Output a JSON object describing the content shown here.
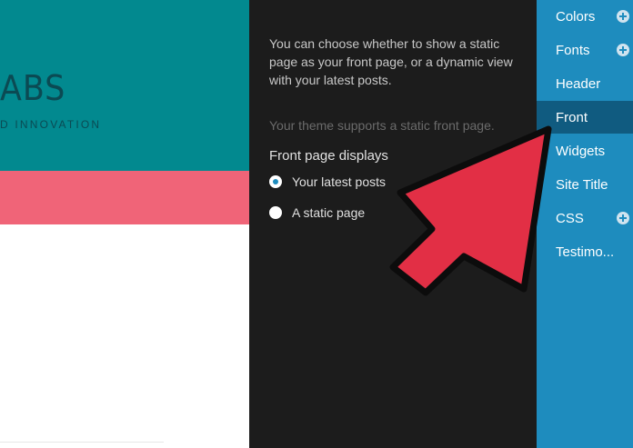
{
  "preview": {
    "brand": "ABS",
    "tagline": "D INNOVATION",
    "colors": {
      "hero": "#02898f",
      "band": "#f06478"
    }
  },
  "panel": {
    "description": "You can choose whether to show a static page as your front page, or a dynamic view with your latest posts.",
    "hint": "Your theme supports a static front page.",
    "front_page_label": "Front page displays",
    "options": [
      {
        "label": "Your latest posts",
        "checked": true
      },
      {
        "label": "A static page",
        "checked": false
      }
    ]
  },
  "menu": {
    "items": [
      {
        "label": "Colors",
        "has_expand": true,
        "active": false
      },
      {
        "label": "Fonts",
        "has_expand": true,
        "active": false
      },
      {
        "label": "Header",
        "has_expand": false,
        "active": false
      },
      {
        "label": "Front",
        "has_expand": false,
        "active": true
      },
      {
        "label": "Widgets",
        "has_expand": false,
        "active": false
      },
      {
        "label": "Site Title",
        "has_expand": false,
        "active": false
      },
      {
        "label": "CSS",
        "has_expand": true,
        "active": false
      },
      {
        "label": "Testimo...",
        "has_expand": false,
        "active": false
      }
    ],
    "colors": {
      "background": "#1e8cbe",
      "active": "#105b80"
    }
  },
  "annotation": {
    "arrow_color": "#e22f45"
  }
}
